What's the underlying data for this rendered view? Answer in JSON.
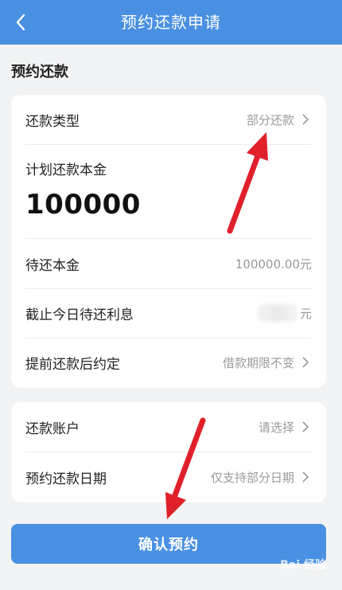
{
  "header": {
    "title": "预约还款申请",
    "back_icon": "chevron-left-icon"
  },
  "section_title": "预约还款",
  "card1": {
    "repay_type": {
      "label": "还款类型",
      "value": "部分还款"
    },
    "planned_principal": {
      "label": "计划还款本金",
      "value": "100000"
    },
    "outstanding_principal": {
      "label": "待还本金",
      "value": "100000.00元"
    },
    "interest_due": {
      "label": "截止今日待还利息",
      "value_suffix": "元"
    },
    "after_prepay": {
      "label": "提前还款后约定",
      "value": "借款期限不变"
    }
  },
  "card2": {
    "account": {
      "label": "还款账户",
      "value": "请选择"
    },
    "date": {
      "label": "预约还款日期",
      "value": "仅支持部分日期"
    }
  },
  "confirm_button": "确认预约",
  "watermark": "Bai 经验",
  "colors": {
    "primary": "#4a90e2",
    "annotation": "#e0202a"
  }
}
